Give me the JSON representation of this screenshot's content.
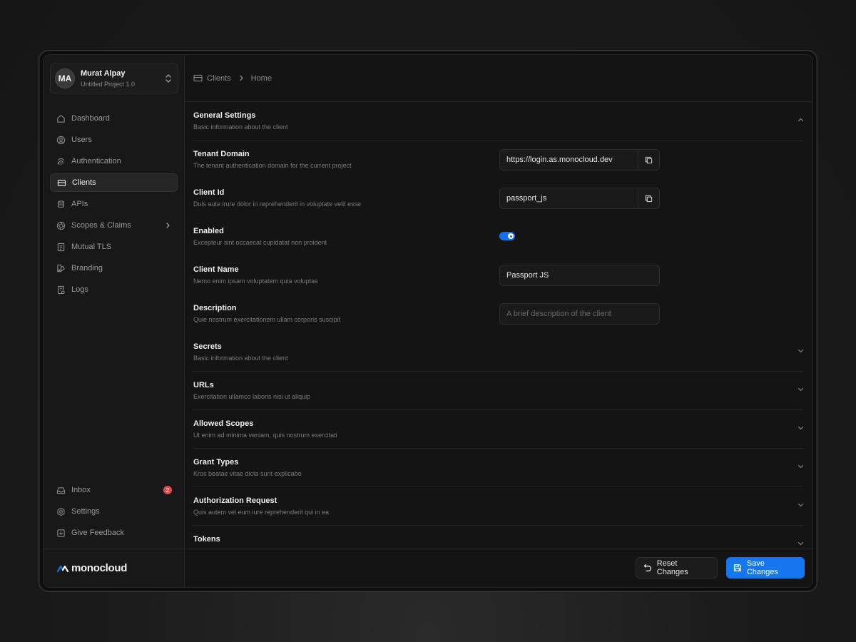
{
  "account": {
    "initials": "MA",
    "name": "Murat Alpay",
    "project": "Untitled Project 1.0"
  },
  "nav": {
    "items": [
      {
        "label": "Dashboard",
        "icon": "home-icon"
      },
      {
        "label": "Users",
        "icon": "user-icon"
      },
      {
        "label": "Authentication",
        "icon": "fingerprint-icon"
      },
      {
        "label": "Clients",
        "icon": "card-icon",
        "active": true
      },
      {
        "label": "APIs",
        "icon": "database-icon"
      },
      {
        "label": "Scopes & Claims",
        "icon": "aperture-icon",
        "has_submenu": true
      },
      {
        "label": "Mutual TLS",
        "icon": "document-icon"
      },
      {
        "label": "Branding",
        "icon": "palette-icon"
      },
      {
        "label": "Logs",
        "icon": "log-file-icon"
      }
    ],
    "bottom": [
      {
        "label": "Inbox",
        "icon": "inbox-icon",
        "badge": "2"
      },
      {
        "label": "Settings",
        "icon": "gear-icon"
      },
      {
        "label": "Give Feedback",
        "icon": "feedback-icon"
      }
    ]
  },
  "brand": {
    "name": "monocloud",
    "accent": "#1477ef"
  },
  "breadcrumb": {
    "items": [
      "Clients",
      "Home"
    ]
  },
  "general": {
    "title": "General Settings",
    "subtitle": "Basic information about the client",
    "fields": {
      "tenant_domain": {
        "label": "Tenant Domain",
        "description": "The tenant authentication domain for the current project",
        "value": "https://login.as.monocloud.dev"
      },
      "client_id": {
        "label": "Client Id",
        "description": "Duis aute irure dolor in reprehenderit in voluptate velit esse",
        "value": "passport_js"
      },
      "enabled": {
        "label": "Enabled",
        "description": "Excepteur sint occaecat cupidatat non proident",
        "value": true
      },
      "client_name": {
        "label": "Client Name",
        "description": "Nemo enim ipsam voluptatem quia voluptas",
        "value": "Passport JS"
      },
      "description": {
        "label": "Description",
        "description": "Quie nostrum exercitationem ullam corporis suscipit",
        "value": "",
        "placeholder": "A brief description of the client"
      }
    }
  },
  "sections": [
    {
      "title": "Secrets",
      "subtitle": "Basic information about the client"
    },
    {
      "title": "URLs",
      "subtitle": "Exercitation ullamco laboris nisi ut aliquip"
    },
    {
      "title": "Allowed Scopes",
      "subtitle": "Ut enim ad minima veniam, quis nostrum exercitati"
    },
    {
      "title": "Grant Types",
      "subtitle": "Kros beatae vitae dicta sunt explicabo"
    },
    {
      "title": "Authorization Request",
      "subtitle": "Quis autem vel eum iure reprehenderit qui in ea"
    },
    {
      "title": "Tokens",
      "subtitle": ""
    }
  ],
  "footer": {
    "reset_label": "Reset Changes",
    "save_label": "Save Changes"
  },
  "colors": {
    "accent": "#1477ef",
    "badge": "#e5484d"
  }
}
